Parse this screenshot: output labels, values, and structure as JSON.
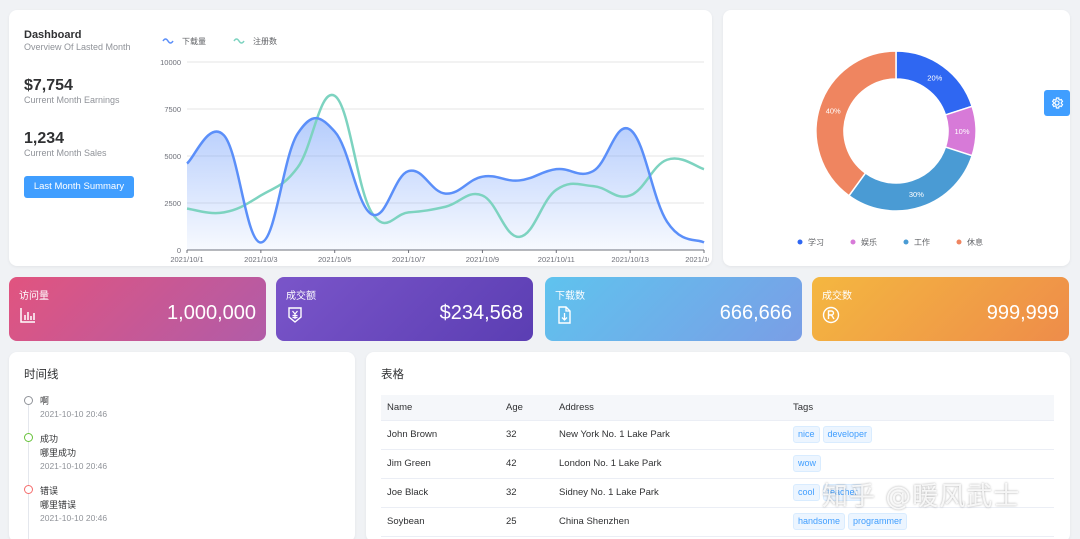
{
  "overview": {
    "title": "Dashboard",
    "subtitle": "Overview Of Lasted Month",
    "earnings_value": "$7,754",
    "earnings_label": "Current Month Earnings",
    "sales_value": "1,234",
    "sales_label": "Current Month Sales",
    "button_label": "Last Month Summary"
  },
  "chart_data": [
    {
      "type": "line",
      "x": [
        "2021/10/1",
        "2021/10/2",
        "2021/10/3",
        "2021/10/4",
        "2021/10/5",
        "2021/10/6",
        "2021/10/7",
        "2021/10/8",
        "2021/10/9",
        "2021/10/10",
        "2021/10/11",
        "2021/10/12",
        "2021/10/13",
        "2021/10/14",
        "2021/10/15"
      ],
      "x_tick_labels": [
        "2021/10/1",
        "2021/10/3",
        "2021/10/5",
        "2021/10/7",
        "2021/10/9",
        "2021/10/11",
        "2021/10/13",
        "2021/10/15"
      ],
      "series": [
        {
          "name": "下载量",
          "color": "#5b8ff9",
          "values": [
            4600,
            6100,
            400,
            6200,
            6300,
            1900,
            4200,
            3000,
            3900,
            3700,
            4300,
            4200,
            6400,
            1500,
            400
          ]
        },
        {
          "name": "注册数",
          "color": "#7dd3c0",
          "values": [
            2200,
            2000,
            2900,
            4400,
            8200,
            2000,
            2000,
            2300,
            2900,
            700,
            3200,
            3400,
            2900,
            4800,
            4300
          ]
        }
      ],
      "y_ticks": [
        0,
        2500,
        5000,
        7500,
        10000
      ],
      "ylim": [
        0,
        10000
      ],
      "legend": "top-left",
      "grid": true
    },
    {
      "type": "pie",
      "categories": [
        "学习",
        "娱乐",
        "工作",
        "休息"
      ],
      "values": [
        20,
        10,
        30,
        40
      ],
      "labels": [
        "20%",
        "10%",
        "30%",
        "40%"
      ],
      "colors": [
        "#2f67f2",
        "#d77ad8",
        "#4a9bd4",
        "#ef8560"
      ],
      "legend": "bottom"
    }
  ],
  "stats": [
    {
      "label": "访问量",
      "value": "1,000,000",
      "icon": "bar-chart-icon"
    },
    {
      "label": "成交额",
      "value": "$234,568",
      "icon": "yen-shield-icon"
    },
    {
      "label": "下载数",
      "value": "666,666",
      "icon": "download-file-icon"
    },
    {
      "label": "成交数",
      "value": "999,999",
      "icon": "registered-icon"
    }
  ],
  "timeline": {
    "title": "时间线",
    "items": [
      {
        "title": "啊",
        "desc": "",
        "time": "2021-10-10 20:46",
        "color": "#909399"
      },
      {
        "title": "成功",
        "desc": "哪里成功",
        "time": "2021-10-10 20:46",
        "color": "#67c23a"
      },
      {
        "title": "错误",
        "desc": "哪里错误",
        "time": "2021-10-10 20:46",
        "color": "#f56c6c"
      }
    ]
  },
  "table": {
    "title": "表格",
    "headers": [
      "Name",
      "Age",
      "Address",
      "Tags"
    ],
    "rows": [
      {
        "name": "John Brown",
        "age": "32",
        "address": "New York No. 1 Lake Park",
        "tags": [
          "nice",
          "developer"
        ]
      },
      {
        "name": "Jim Green",
        "age": "42",
        "address": "London No. 1 Lake Park",
        "tags": [
          "wow"
        ]
      },
      {
        "name": "Joe Black",
        "age": "32",
        "address": "Sidney No. 1 Lake Park",
        "tags": [
          "cool",
          "teacher"
        ]
      },
      {
        "name": "Soybean",
        "age": "25",
        "address": "China Shenzhen",
        "tags": [
          "handsome",
          "programmer"
        ]
      }
    ]
  },
  "watermark": "知乎 @暖风武士"
}
